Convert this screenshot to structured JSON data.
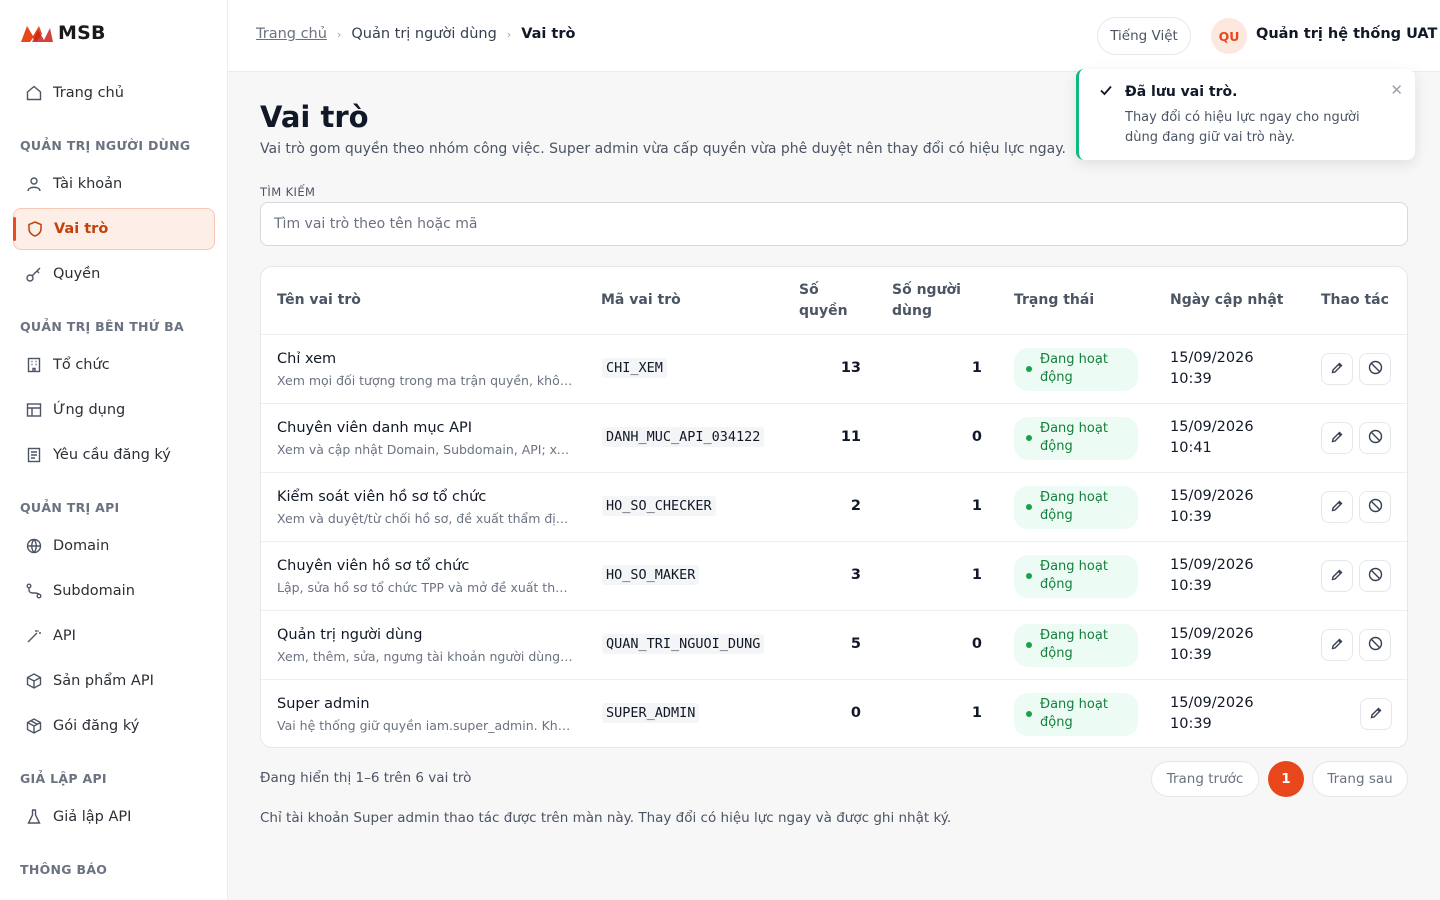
{
  "brand": {
    "name": "MSB",
    "accent": "#e8471c"
  },
  "sidebar": {
    "home": {
      "label": "Trang chủ",
      "icon": "home-icon"
    },
    "sections": [
      {
        "title": "QUẢN TRỊ NGƯỜI DÙNG",
        "items": [
          {
            "label": "Tài khoản",
            "icon": "user-icon"
          },
          {
            "label": "Vai trò",
            "icon": "shield-icon",
            "active": true
          },
          {
            "label": "Quyền",
            "icon": "key-icon"
          }
        ]
      },
      {
        "title": "QUẢN TRỊ BÊN THỨ BA",
        "items": [
          {
            "label": "Tổ chức",
            "icon": "building-icon"
          },
          {
            "label": "Ứng dụng",
            "icon": "app-window-icon"
          },
          {
            "label": "Yêu cầu đăng ký",
            "icon": "document-icon"
          }
        ]
      },
      {
        "title": "QUẢN TRỊ API",
        "items": [
          {
            "label": "Domain",
            "icon": "globe-icon"
          },
          {
            "label": "Subdomain",
            "icon": "route-icon"
          },
          {
            "label": "API",
            "icon": "wand-icon"
          },
          {
            "label": "Sản phẩm API",
            "icon": "box-icon"
          },
          {
            "label": "Gói đăng ký",
            "icon": "package-icon"
          }
        ]
      },
      {
        "title": "GIẢ LẬP API",
        "items": [
          {
            "label": "Giả lập API",
            "icon": "flask-icon"
          }
        ]
      },
      {
        "title": "THÔNG BÁO",
        "items": []
      }
    ]
  },
  "header": {
    "breadcrumb": [
      "Trang chủ",
      "Quản trị người dùng",
      "Vai trò"
    ],
    "language": "Tiếng Việt",
    "avatar_initials": "QU",
    "user_name": "Quản trị hệ thống UAT"
  },
  "toast": {
    "title": "Đã lưu vai trò.",
    "body": "Thay đổi có hiệu lực ngay cho người dùng đang giữ vai trò này.",
    "color": "#10b981"
  },
  "page": {
    "title": "Vai trò",
    "description": "Vai trò gom quyền theo nhóm công việc. Super admin vừa cấp quyền vừa phê duyệt nên thay đổi có hiệu lực ngay.",
    "search_label": "TÌM KIẾM",
    "search_placeholder": "Tìm vai trò theo tên hoặc mã",
    "search_value": ""
  },
  "table": {
    "columns": [
      "Tên vai trò",
      "Mã vai trò",
      "Số quyền",
      "Số người dùng",
      "Trạng thái",
      "Ngày cập nhật",
      "Thao tác"
    ],
    "rows": [
      {
        "name": "Chỉ xem",
        "desc": "Xem mọi đối tượng trong ma trận quyền, không s...",
        "code": "CHI_XEM",
        "perms": "13",
        "users": "1",
        "status": "Đang hoạt động",
        "date": "15/09/2026",
        "time": "10:39"
      },
      {
        "name": "Chuyên viên danh mục API",
        "desc": "Xem và cập nhật Domain, Subdomain, API; xem ...",
        "code": "DANH_MUC_API_034122",
        "perms": "11",
        "users": "0",
        "status": "Đang hoạt động",
        "date": "15/09/2026",
        "time": "10:41"
      },
      {
        "name": "Kiểm soát viên hồ sơ tổ chức",
        "desc": "Xem và duyệt/từ chối hồ sơ, đề xuất thẩm định c...",
        "code": "HO_SO_CHECKER",
        "perms": "2",
        "users": "1",
        "status": "Đang hoạt động",
        "date": "15/09/2026",
        "time": "10:39"
      },
      {
        "name": "Chuyên viên hồ sơ tổ chức",
        "desc": "Lập, sửa hồ sơ tổ chức TPP và mở đề xuất thẩm ...",
        "code": "HO_SO_MAKER",
        "perms": "3",
        "users": "1",
        "status": "Đang hoạt động",
        "date": "15/09/2026",
        "time": "10:39"
      },
      {
        "name": "Quản trị người dùng",
        "desc": "Xem, thêm, sửa, ngưng tài khoản người dùng; xe...",
        "code": "QUAN_TRI_NGUOI_DUNG",
        "perms": "5",
        "users": "0",
        "status": "Đang hoạt động",
        "date": "15/09/2026",
        "time": "10:39"
      },
      {
        "name": "Super admin",
        "desc": "Vai hệ thống giữ quyền iam.super_admin. Không...",
        "code": "SUPER_ADMIN",
        "perms": "0",
        "users": "1",
        "status": "Đang hoạt động",
        "date": "15/09/2026",
        "time": "10:39"
      }
    ]
  },
  "pagination": {
    "info": "Đang hiển thị 1–6 trên 6 vai trò",
    "prev": "Trang trước",
    "page": "1",
    "next": "Trang sau"
  },
  "footnote": "Chỉ tài khoản Super admin thao tác được trên màn này. Thay đổi có hiệu lực ngay và được ghi nhật ký."
}
